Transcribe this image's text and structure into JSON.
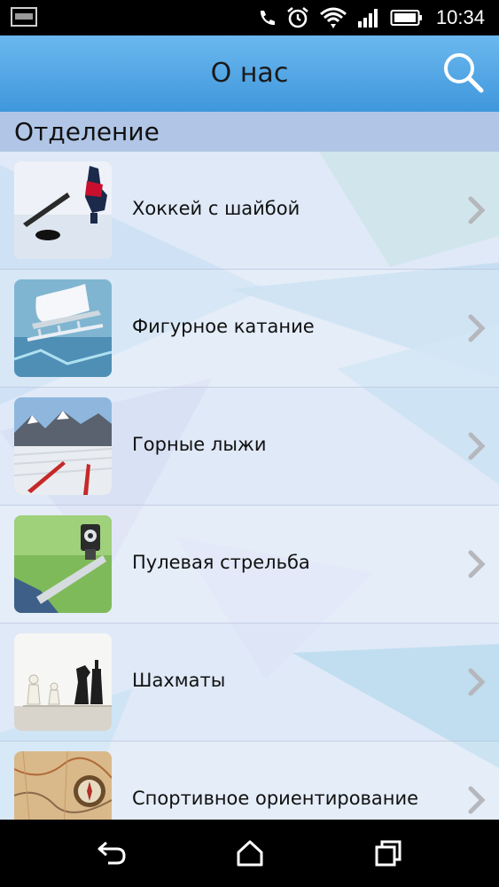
{
  "status_bar": {
    "time": "10:34",
    "icons": [
      "gallery-icon",
      "phone-icon",
      "alarm-icon",
      "wifi-icon",
      "signal-icon",
      "battery-icon"
    ]
  },
  "app_bar": {
    "title": "О нас",
    "search_icon": "search-icon"
  },
  "section": {
    "title": "Отделение"
  },
  "items": [
    {
      "label": "Хоккей с шайбой",
      "icon": "hockey-icon"
    },
    {
      "label": "Фигурное катание",
      "icon": "figure-skating-icon"
    },
    {
      "label": "Горные лыжи",
      "icon": "alpine-skiing-icon"
    },
    {
      "label": "Пулевая стрельба",
      "icon": "shooting-icon"
    },
    {
      "label": "Шахматы",
      "icon": "chess-icon"
    },
    {
      "label": "Спортивное ориентирование",
      "icon": "orienteering-icon"
    }
  ],
  "nav_bar": {
    "buttons": [
      "back-icon",
      "home-icon",
      "recents-icon"
    ]
  },
  "colors": {
    "app_bar": "#4aa3e4",
    "section_header": "#b1c6e6",
    "background": "#dfe9f7"
  }
}
